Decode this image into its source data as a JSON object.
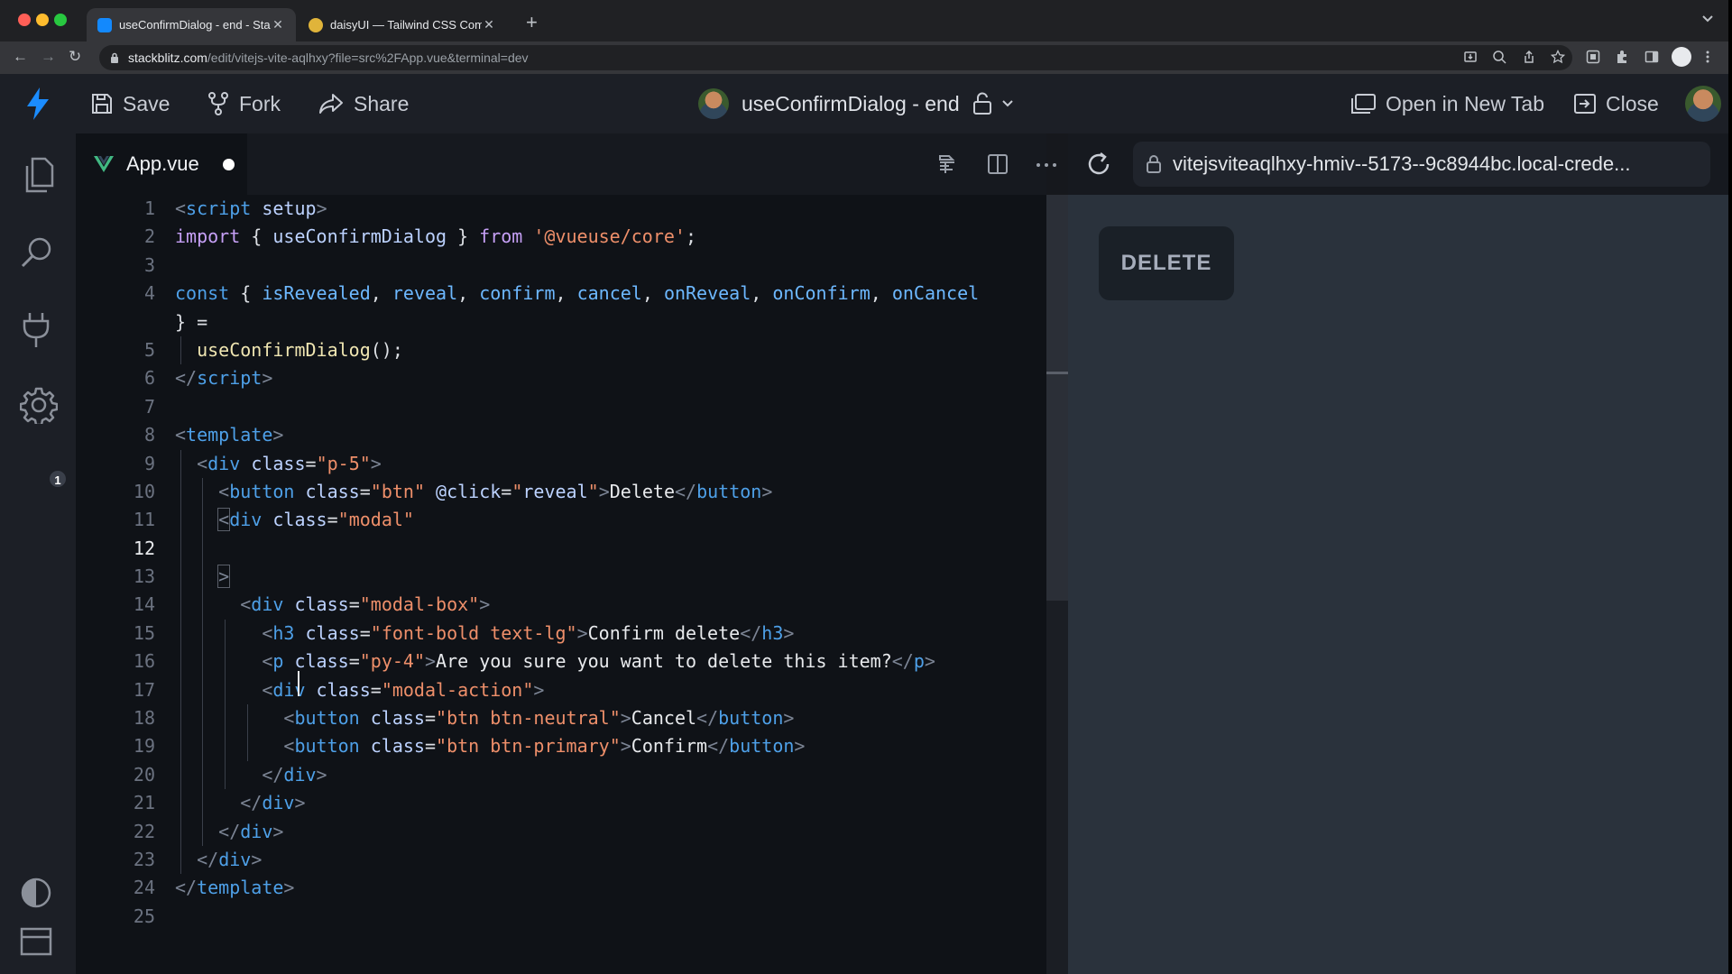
{
  "browser": {
    "tabs": [
      {
        "title": "useConfirmDialog - end - Stac",
        "active": true
      },
      {
        "title": "daisyUI — Tailwind CSS Compo",
        "active": false
      }
    ],
    "new_tab": "+",
    "url_host": "stackblitz.com",
    "url_path": "/edit/vitejs-vite-aqlhxy?file=src%2FApp.vue&terminal=dev"
  },
  "header": {
    "save_label": "Save",
    "fork_label": "Fork",
    "share_label": "Share",
    "project_title": "useConfirmDialog - end",
    "open_new_tab_label": "Open in New Tab",
    "close_label": "Close"
  },
  "activity": {
    "extensions_badge": "1"
  },
  "editor": {
    "tab_label": "App.vue",
    "current_line": 12,
    "line_numbers": [
      "1",
      "2",
      "3",
      "4",
      "",
      "5",
      "6",
      "7",
      "8",
      "9",
      "10",
      "11",
      "12",
      "13",
      "14",
      "15",
      "16",
      "17",
      "18",
      "19",
      "20",
      "21",
      "22",
      "23",
      "24",
      "25"
    ]
  },
  "preview": {
    "url": "vitejsviteaqlhxy-hmiv--5173--9c8944bc.local-crede...",
    "delete_button": "DELETE"
  },
  "colors": {
    "accent": "#4f9df7",
    "string": "#ee8f6a",
    "tag": "#4ea0e8",
    "keyword": "#c6a0f6"
  }
}
